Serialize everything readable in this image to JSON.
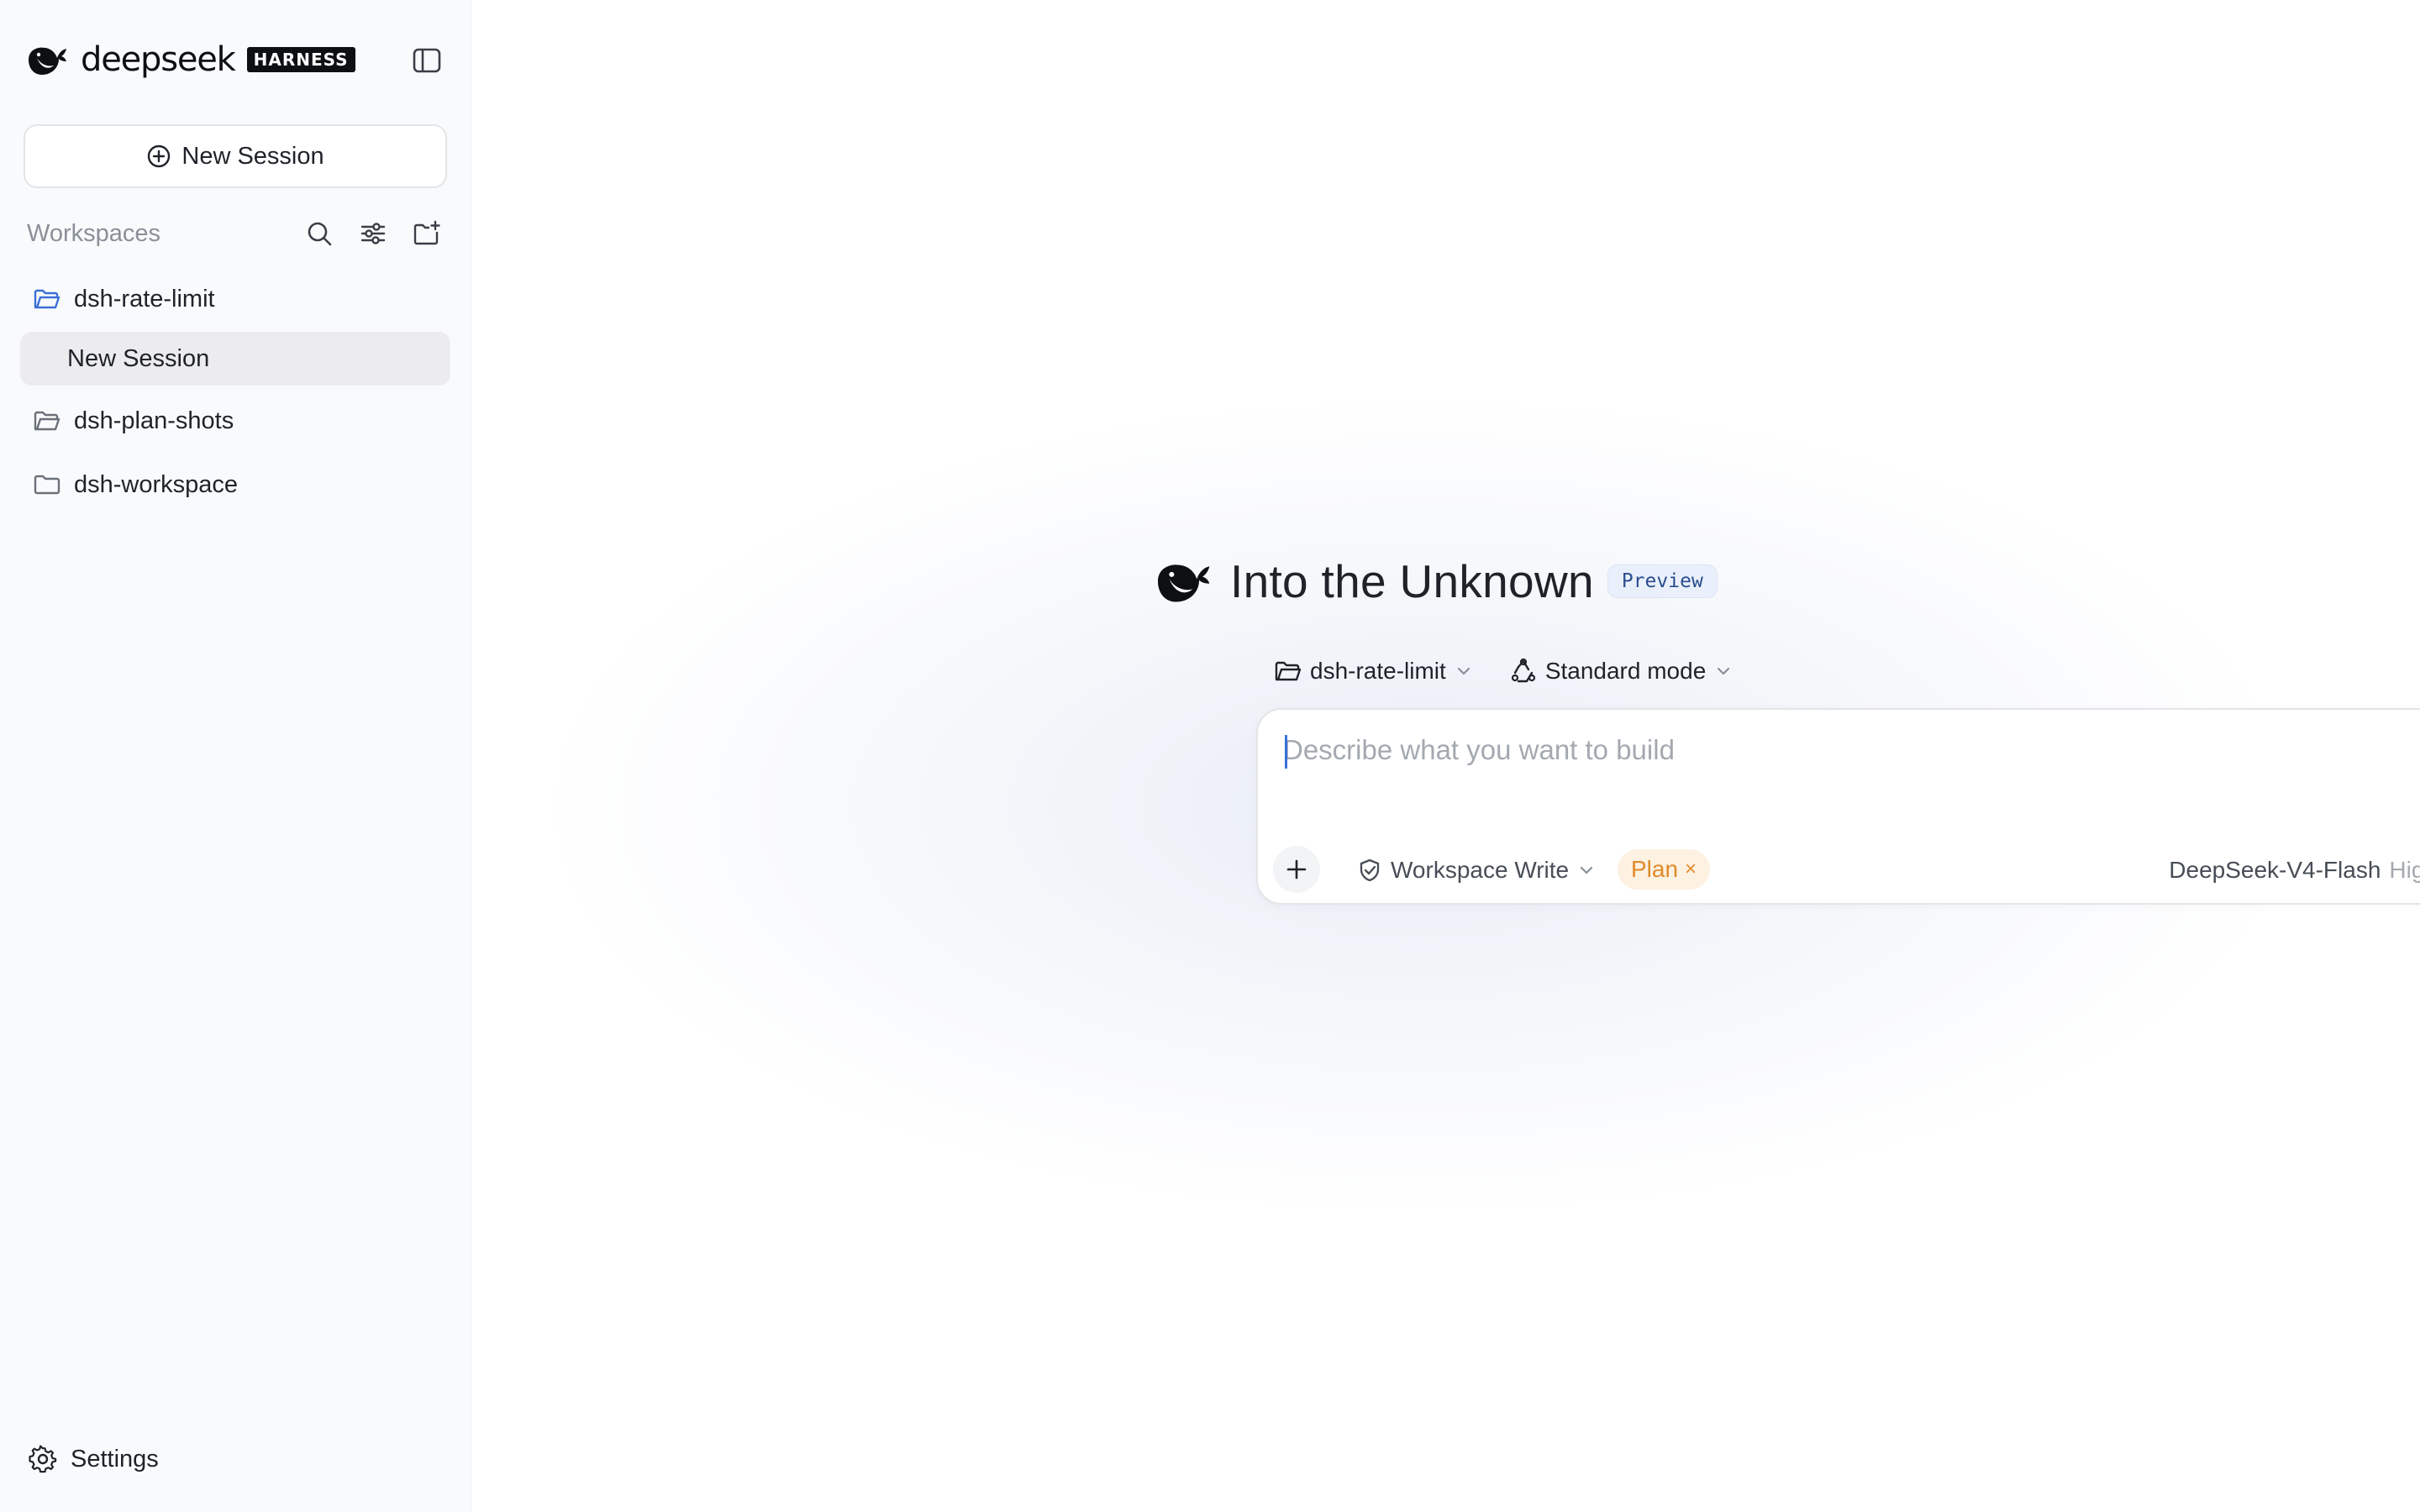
{
  "sidebar": {
    "brand": {
      "name": "deepseek",
      "tag": "HARNESS"
    },
    "new_session_label": "New Session",
    "workspaces_title": "Workspaces",
    "items": [
      {
        "label": "dsh-rate-limit",
        "type": "workspace",
        "icon": "folder-open-icon",
        "active": true
      },
      {
        "label": "New Session",
        "type": "session",
        "selected": true
      },
      {
        "label": "dsh-plan-shots",
        "type": "workspace",
        "icon": "folder-open-icon"
      },
      {
        "label": "dsh-workspace",
        "type": "workspace",
        "icon": "folder-icon"
      }
    ],
    "settings_label": "Settings"
  },
  "main": {
    "hero_title": "Into the Unknown",
    "hero_badge": "Preview",
    "context": {
      "workspace": "dsh-rate-limit",
      "mode": "Standard mode"
    },
    "composer": {
      "placeholder": "Describe what you want to build",
      "value": "",
      "permission": "Workspace Write",
      "plan_chip": "Plan",
      "plan_close": "×",
      "model": "DeepSeek-V4-Flash",
      "effort": "High"
    }
  },
  "colors": {
    "accent": "#3b6fd8",
    "send_button": "#a9c2f2",
    "plan_chip_bg": "#fdf1e2",
    "plan_chip_text": "#e08a2a",
    "sidebar_bg": "#f9fafb",
    "selected_row": "#ececee",
    "active_folder_icon": "#3b6fd8"
  }
}
